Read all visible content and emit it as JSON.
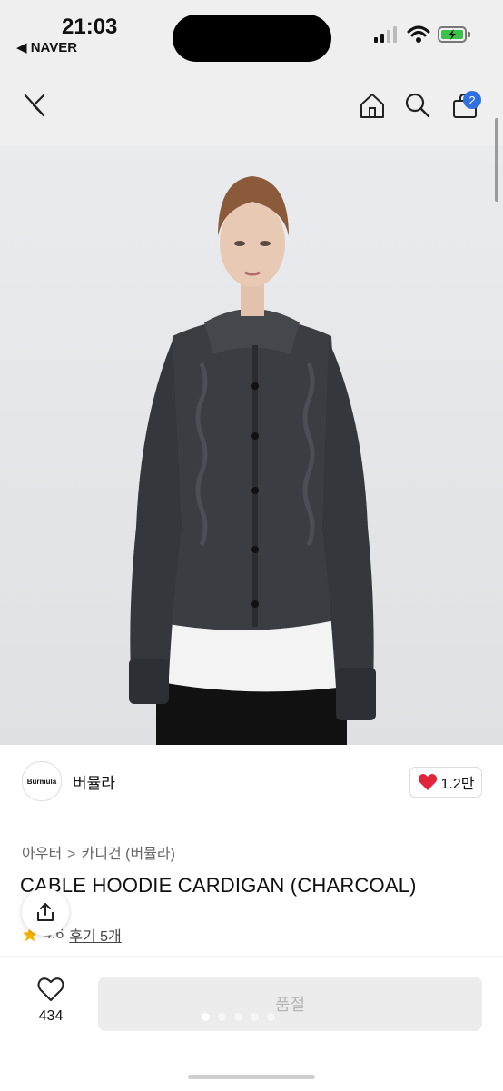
{
  "status_bar": {
    "time": "21:03",
    "back_app": "◀ NAVER"
  },
  "header": {
    "cart_count": "2"
  },
  "brand": {
    "logo_text": "Burmula",
    "name": "버뮬라",
    "likes": "1.2만"
  },
  "breadcrumb": {
    "level1": "아우터",
    "separator": ">",
    "level2": "카디건 (버뮬라)"
  },
  "product": {
    "title": "CABLE HOODIE CARDIGAN (CHARCOAL)",
    "rating": "4.6",
    "reviews": "후기 5개"
  },
  "bottom_bar": {
    "wish_count": "434",
    "status_button": "품절"
  },
  "colors": {
    "accent_badge": "#2f6fe0",
    "heart": "#e0243a",
    "star": "#f5b400"
  },
  "gallery": {
    "page_count": 5,
    "current_page": 1
  }
}
